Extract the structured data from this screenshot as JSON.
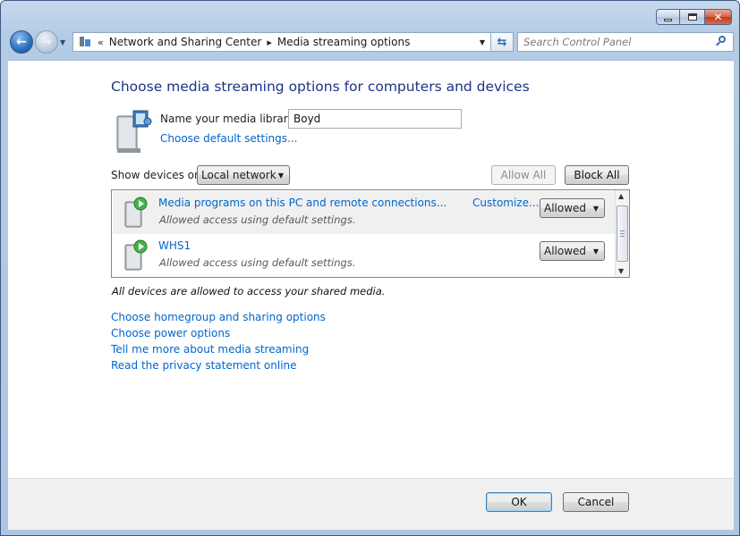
{
  "window": {
    "caption": {
      "minimize": "minimize",
      "maximize": "maximize",
      "close": "close"
    }
  },
  "nav": {
    "breadcrumb_root_sep": "«",
    "breadcrumbs": [
      "Network and Sharing Center",
      "Media streaming options"
    ],
    "crumb_sep": "▸",
    "search_placeholder": "Search Control Panel"
  },
  "main": {
    "heading": "Choose media streaming options for computers and devices",
    "library_label": "Name your media library:",
    "library_value": "Boyd",
    "choose_default": "Choose default settings...",
    "show_devices_label": "Show devices on:",
    "show_devices_value": "Local network",
    "allow_all": "Allow All",
    "block_all": "Block All",
    "devices": [
      {
        "name": "Media programs on this PC and remote connections...",
        "description": "Allowed access using default settings.",
        "customize": "Customize...",
        "permission": "Allowed"
      },
      {
        "name": "WHS1",
        "description": "Allowed access using default settings.",
        "permission": "Allowed"
      }
    ],
    "note": "All devices are allowed to access your shared media.",
    "links": [
      "Choose homegroup and sharing options",
      "Choose power options",
      "Tell me more about media streaming",
      "Read the privacy statement online"
    ]
  },
  "footer": {
    "ok": "OK",
    "cancel": "Cancel"
  },
  "colors": {
    "link": "#0066cc",
    "heading": "#1e3287",
    "selected_row": "#f0f0f0"
  }
}
